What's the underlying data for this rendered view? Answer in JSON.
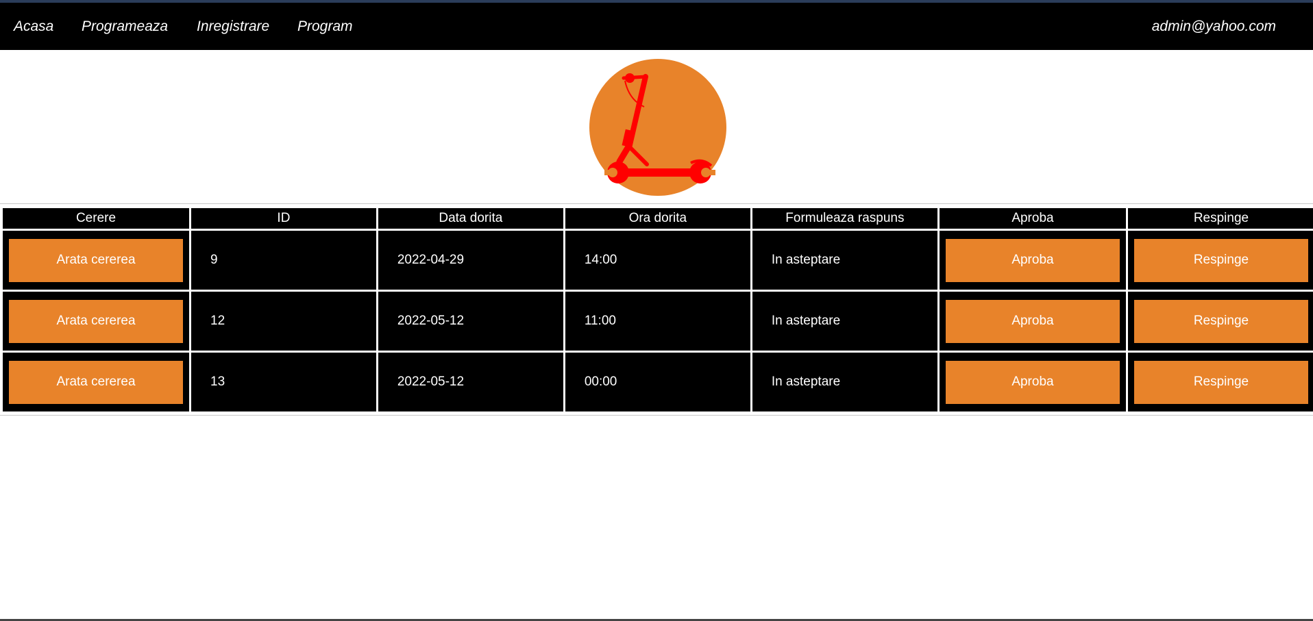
{
  "nav": {
    "links": [
      {
        "label": "Acasa"
      },
      {
        "label": "Programeaza"
      },
      {
        "label": "Inregistrare"
      },
      {
        "label": "Program"
      }
    ],
    "user_email": "admin@yahoo.com"
  },
  "logo": {
    "icon": "scooter-wrench-icon",
    "circle_color": "#E8832A",
    "icon_color": "#FF0000"
  },
  "table": {
    "headers": [
      "Cerere",
      "ID",
      "Data dorita",
      "Ora dorita",
      "Formuleaza raspuns",
      "Aproba",
      "Respinge"
    ],
    "rows": [
      {
        "view_label": "Arata cererea",
        "id": "9",
        "date": "2022-04-29",
        "time": "14:00",
        "status": "In asteptare",
        "approve_label": "Aproba",
        "reject_label": "Respinge"
      },
      {
        "view_label": "Arata cererea",
        "id": "12",
        "date": "2022-05-12",
        "time": "11:00",
        "status": "In asteptare",
        "approve_label": "Aproba",
        "reject_label": "Respinge"
      },
      {
        "view_label": "Arata cererea",
        "id": "13",
        "date": "2022-05-12",
        "time": "00:00",
        "status": "In asteptare",
        "approve_label": "Aproba",
        "reject_label": "Respinge"
      }
    ]
  },
  "colors": {
    "accent": "#E8832A",
    "navbar": "#000000",
    "table_cell": "#000000"
  }
}
